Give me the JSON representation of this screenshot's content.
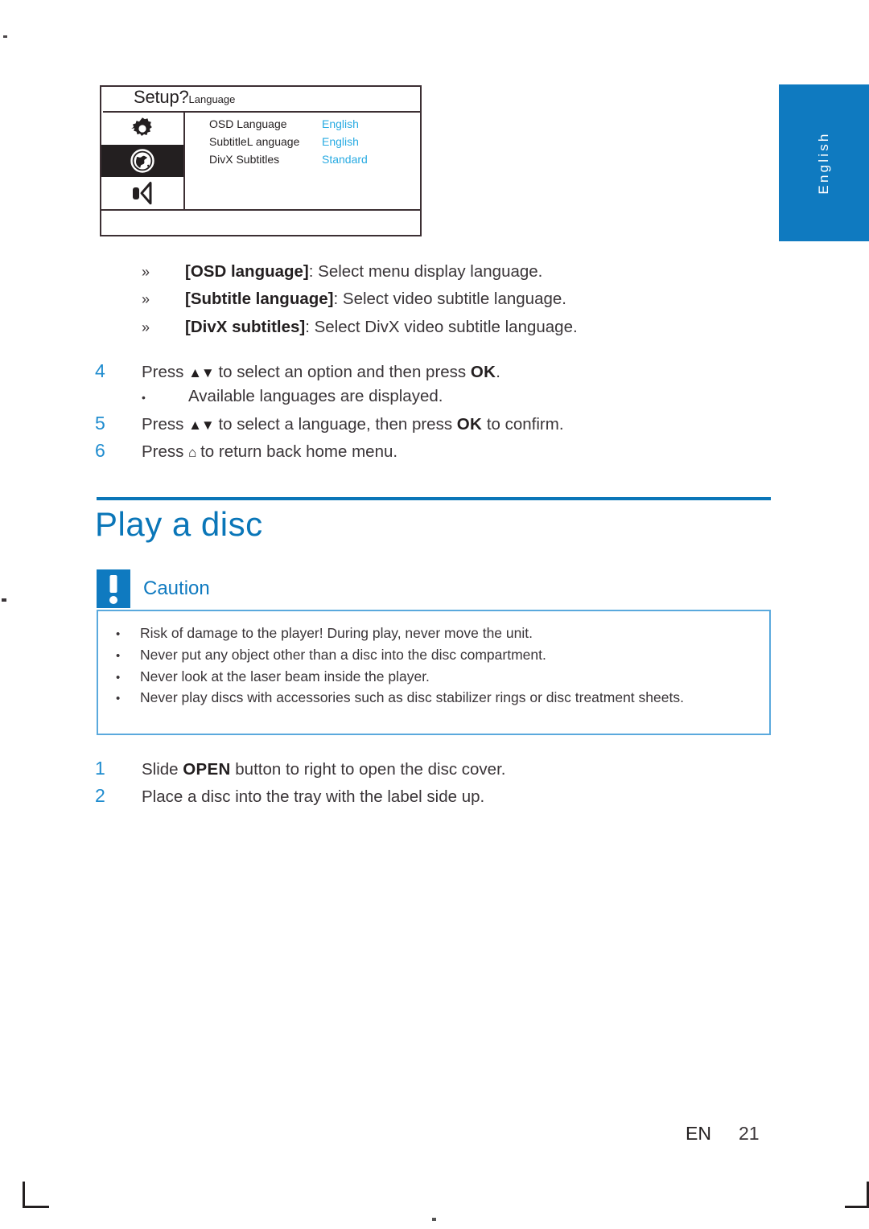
{
  "page": {
    "language_tab": "English",
    "footer_locale": "EN",
    "footer_page": "21"
  },
  "osd_screen": {
    "title_main": "Setup?",
    "title_sub": "Language",
    "icons": [
      {
        "name": "gear-icon",
        "selected": false
      },
      {
        "name": "globe-icon",
        "selected": true
      },
      {
        "name": "speaker-icon",
        "selected": false
      }
    ],
    "rows": [
      {
        "label": "OSD Language",
        "value": "English"
      },
      {
        "label": "SubtitleL anguage",
        "value": "English"
      },
      {
        "label": "DivX Subtitles",
        "value": "Standard"
      }
    ]
  },
  "sub_bullets": {
    "marker": "»",
    "items": [
      {
        "term": "[OSD language]",
        "desc": ": Select menu display language."
      },
      {
        "term": "[Subtitle language]",
        "desc": ": Select video subtitle language."
      },
      {
        "term": "[DivX subtitles]",
        "desc": ": Select DivX video subtitle language."
      }
    ]
  },
  "steps_language": [
    {
      "num": "4",
      "parts": [
        {
          "t": "Press ",
          "style": "normal"
        },
        {
          "t": "▲▼",
          "style": "glyph"
        },
        {
          "t": " to select an option and then press ",
          "style": "normal"
        },
        {
          "t": "OK",
          "style": "bold"
        },
        {
          "t": ".",
          "style": "normal"
        }
      ]
    },
    {
      "num": "5",
      "parts": [
        {
          "t": "Press ",
          "style": "normal"
        },
        {
          "t": "▲▼",
          "style": "glyph"
        },
        {
          "t": " to select a language, then press ",
          "style": "normal"
        },
        {
          "t": "OK",
          "style": "bold"
        },
        {
          "t": " to confirm.",
          "style": "normal"
        }
      ]
    },
    {
      "num": "6",
      "parts": [
        {
          "t": "Press ",
          "style": "normal"
        },
        {
          "t": "⌂",
          "style": "glyph"
        },
        {
          "t": " to return back home menu.",
          "style": "normal"
        }
      ]
    }
  ],
  "step_note": {
    "dot": "•",
    "text": "Available languages are displayed."
  },
  "section": {
    "title": "Play a disc"
  },
  "caution": {
    "label": "Caution",
    "icon": "exclamation-icon",
    "bullet": "•",
    "items": [
      "Risk of damage to the player! During play, never move the unit.",
      "Never put any object other than a disc into the disc compartment.",
      "Never look at the laser beam inside the player.",
      "Never play discs with accessories such as disc stabilizer rings or disc treatment sheets."
    ]
  },
  "steps_play": [
    {
      "num": "1",
      "parts": [
        {
          "t": "Slide ",
          "style": "normal"
        },
        {
          "t": "OPEN",
          "style": "bold"
        },
        {
          "t": " button to right to open the disc cover.",
          "style": "normal"
        }
      ]
    },
    {
      "num": "2",
      "parts": [
        {
          "t": "Place a disc into the tray with the label side up.",
          "style": "normal"
        }
      ]
    }
  ],
  "colors": {
    "brand_blue": "#0f7ac0",
    "heading_blue": "#0a76b8",
    "osd_value_cyan": "#29abe2",
    "step_number_blue": "#1f8ccf",
    "caution_border": "#5aa9dd",
    "text_dark": "#231f20"
  }
}
